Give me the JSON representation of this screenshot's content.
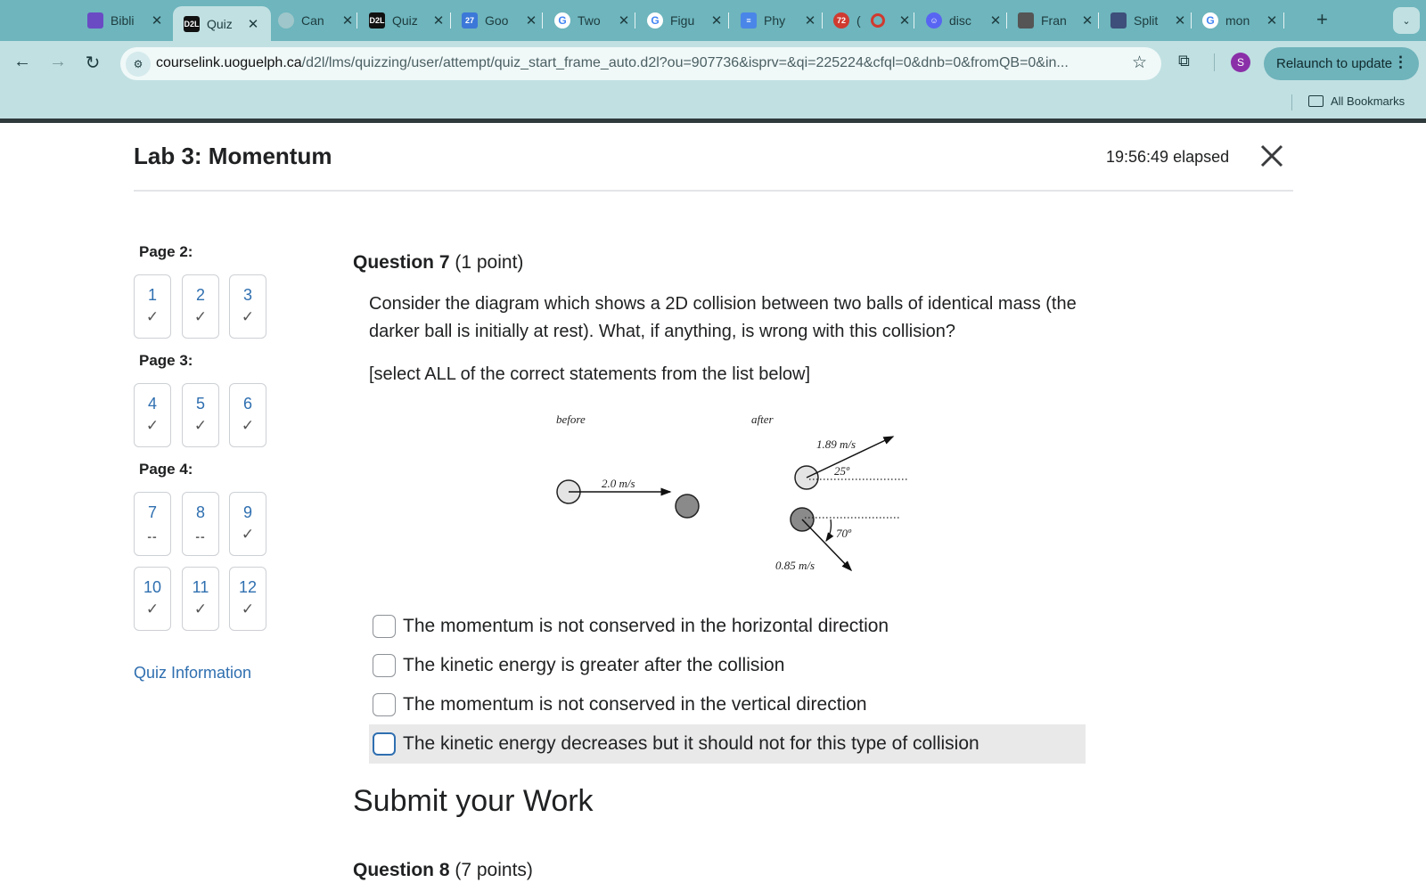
{
  "browser": {
    "tabs": [
      {
        "title": "Bibli",
        "icon": "bibliography-icon",
        "color": "#6a4bc4"
      },
      {
        "title": "Quiz",
        "icon": "d2l-icon",
        "color": "#111111",
        "active": true
      },
      {
        "title": "Can",
        "icon": "canvas-icon",
        "color": "#9fc6ca"
      },
      {
        "title": "Quiz",
        "icon": "d2l-icon",
        "color": "#111111"
      },
      {
        "title": "Goo",
        "icon": "google-calendar-icon",
        "color": "#3c78d8"
      },
      {
        "title": "Two",
        "icon": "google-icon",
        "color": "#ffffff"
      },
      {
        "title": "Figu",
        "icon": "google-icon",
        "color": "#ffffff"
      },
      {
        "title": "Phy",
        "icon": "google-docs-icon",
        "color": "#4a86e8"
      },
      {
        "title": "(",
        "icon": "notification-icon",
        "color": "#d03a2f"
      },
      {
        "title": "disc",
        "icon": "discord-icon",
        "color": "#5865f2"
      },
      {
        "title": "Fran",
        "icon": "profile-icon",
        "color": "#ffffff"
      },
      {
        "title": "Split",
        "icon": "gif-icon",
        "color": "#3d4f7a"
      },
      {
        "title": "mon",
        "icon": "google-icon",
        "color": "#ffffff"
      }
    ],
    "tab_icon_labels": {
      "d2l": "D2L",
      "calendar": "27",
      "notif": "72",
      "google": "G"
    },
    "url_host": "courselink.uoguelph.ca",
    "url_path": "/d2l/lms/quizzing/user/attempt/quiz_start_frame_auto.d2l?ou=907736&isprv=&qi=225224&cfql=0&dnb=0&fromQB=0&in...",
    "profile_initial": "S",
    "relaunch_label": "Relaunch to update",
    "bookmarks_label": "All Bookmarks"
  },
  "quiz": {
    "title": "Lab 3: Momentum",
    "elapsed": "19:56:49 elapsed",
    "nav": {
      "pages": [
        {
          "label": "Page 2:",
          "questions": [
            {
              "num": "1",
              "status": "answered"
            },
            {
              "num": "2",
              "status": "answered"
            },
            {
              "num": "3",
              "status": "answered"
            }
          ]
        },
        {
          "label": "Page 3:",
          "questions": [
            {
              "num": "4",
              "status": "answered"
            },
            {
              "num": "5",
              "status": "answered"
            },
            {
              "num": "6",
              "status": "answered"
            }
          ]
        },
        {
          "label": "Page 4:",
          "questions": [
            {
              "num": "7",
              "status": "unanswered"
            },
            {
              "num": "8",
              "status": "unanswered"
            },
            {
              "num": "9",
              "status": "answered"
            },
            {
              "num": "10",
              "status": "answered"
            },
            {
              "num": "11",
              "status": "answered"
            },
            {
              "num": "12",
              "status": "answered"
            }
          ]
        }
      ],
      "answered_mark": "✓",
      "unanswered_mark": "--",
      "quiz_information_link": "Quiz Information"
    },
    "question7": {
      "number_label": "Question 7",
      "points": "(1 point)",
      "text": "Consider the diagram which shows a 2D collision between two balls of identical mass (the darker ball is initially at rest).  What, if anything, is wrong with this collision?",
      "instruction": "[select ALL of the correct statements from the list below]",
      "diagram": {
        "before_label": "before",
        "after_label": "after",
        "initial_speed": "2.0 m/s",
        "light_ball_final_speed": "1.89 m/s",
        "light_ball_angle": "25º",
        "dark_ball_final_speed": "0.85 m/s",
        "dark_ball_angle": "70º"
      },
      "options": [
        {
          "label": "The momentum is not conserved in the horizontal direction",
          "checked": false
        },
        {
          "label": "The kinetic energy is greater after the collision",
          "checked": false
        },
        {
          "label": "The momentum is not conserved in the vertical direction",
          "checked": false
        },
        {
          "label": "The kinetic energy decreases but it should not for this type of collision",
          "checked": false,
          "hovered": true
        }
      ]
    },
    "submit_heading": "Submit your Work",
    "question8": {
      "number_label": "Question 8",
      "points": "(7 points)"
    }
  }
}
